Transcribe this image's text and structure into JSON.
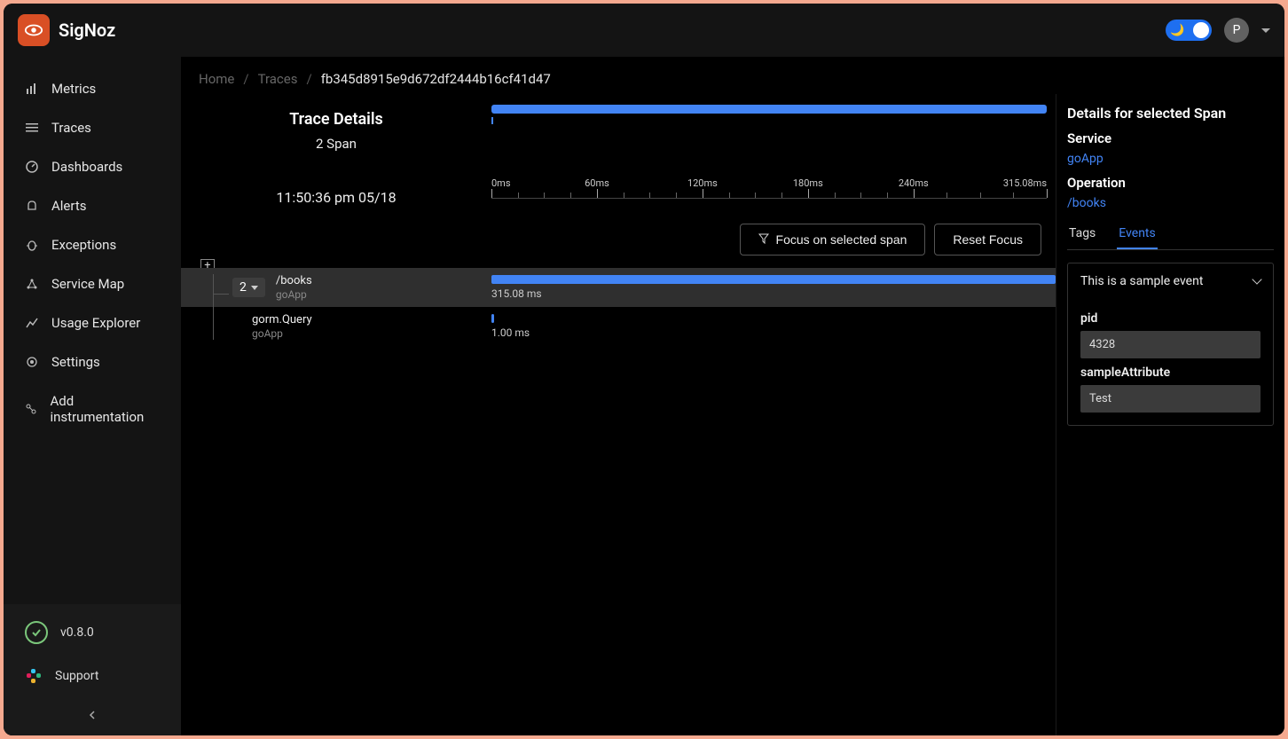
{
  "brand": {
    "name": "SigNoz"
  },
  "topbar": {
    "avatar_initial": "P"
  },
  "sidebar": {
    "items": [
      {
        "label": "Metrics"
      },
      {
        "label": "Traces"
      },
      {
        "label": "Dashboards"
      },
      {
        "label": "Alerts"
      },
      {
        "label": "Exceptions"
      },
      {
        "label": "Service Map"
      },
      {
        "label": "Usage Explorer"
      },
      {
        "label": "Settings"
      },
      {
        "label": "Add instrumentation"
      }
    ],
    "version": "v0.8.0",
    "support": "Support"
  },
  "breadcrumb": {
    "home": "Home",
    "traces": "Traces",
    "trace_id": "fb345d8915e9d672df2444b16cf41d47"
  },
  "trace": {
    "title": "Trace Details",
    "span_count": "2 Span",
    "timestamp": "11:50:36 pm 05/18",
    "focus_btn": "Focus on selected span",
    "reset_btn": "Reset Focus",
    "ruler": [
      "0ms",
      "60ms",
      "120ms",
      "180ms",
      "240ms",
      "315.08ms"
    ],
    "spans": [
      {
        "count": "2",
        "operation": "/books",
        "service": "goApp",
        "duration": "315.08 ms"
      },
      {
        "operation": "gorm.Query",
        "service": "goApp",
        "duration": "1.00 ms"
      }
    ]
  },
  "details": {
    "title": "Details for selected Span",
    "service_label": "Service",
    "service_value": "goApp",
    "operation_label": "Operation",
    "operation_value": "/books",
    "tabs": {
      "tags": "Tags",
      "events": "Events"
    },
    "event": {
      "name": "This is a sample event",
      "attrs": [
        {
          "key": "pid",
          "value": "4328"
        },
        {
          "key": "sampleAttribute",
          "value": "Test"
        }
      ]
    }
  }
}
